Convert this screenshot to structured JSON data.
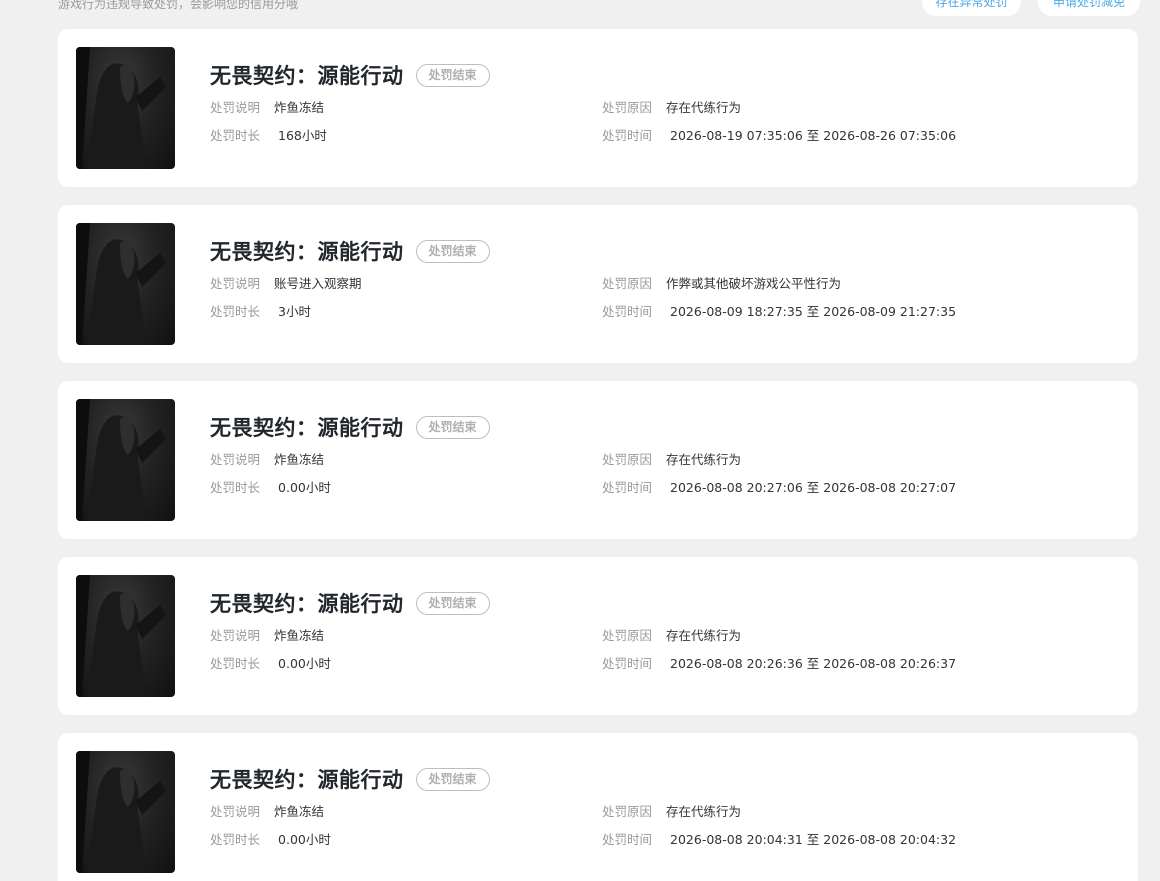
{
  "header": {
    "notice": "游戏行为违规导致处罚，会影响您的信用分哦",
    "btn_abnormal": "存在异常处罚",
    "btn_apply": "申请处罚减免"
  },
  "labels": {
    "desc": "处罚说明",
    "duration": "处罚时长",
    "reason": "处罚原因",
    "time": "处罚时间",
    "to": "至"
  },
  "records": [
    {
      "game": "无畏契约：源能行动",
      "status": "处罚结束",
      "desc": "炸鱼冻结",
      "duration": "168小时",
      "reason": "存在代练行为",
      "start": "2026-08-19 07:35:06",
      "end": "2026-08-26 07:35:06"
    },
    {
      "game": "无畏契约：源能行动",
      "status": "处罚结束",
      "desc": "账号进入观察期",
      "duration": "3小时",
      "reason": "作弊或其他破坏游戏公平性行为",
      "start": "2026-08-09 18:27:35",
      "end": "2026-08-09 21:27:35"
    },
    {
      "game": "无畏契约：源能行动",
      "status": "处罚结束",
      "desc": "炸鱼冻结",
      "duration": "0.00小时",
      "reason": "存在代练行为",
      "start": "2026-08-08 20:27:06",
      "end": "2026-08-08 20:27:07"
    },
    {
      "game": "无畏契约：源能行动",
      "status": "处罚结束",
      "desc": "炸鱼冻结",
      "duration": "0.00小时",
      "reason": "存在代练行为",
      "start": "2026-08-08 20:26:36",
      "end": "2026-08-08 20:26:37"
    },
    {
      "game": "无畏契约：源能行动",
      "status": "处罚结束",
      "desc": "炸鱼冻结",
      "duration": "0.00小时",
      "reason": "存在代练行为",
      "start": "2026-08-08 20:04:31",
      "end": "2026-08-08 20:04:32"
    }
  ]
}
